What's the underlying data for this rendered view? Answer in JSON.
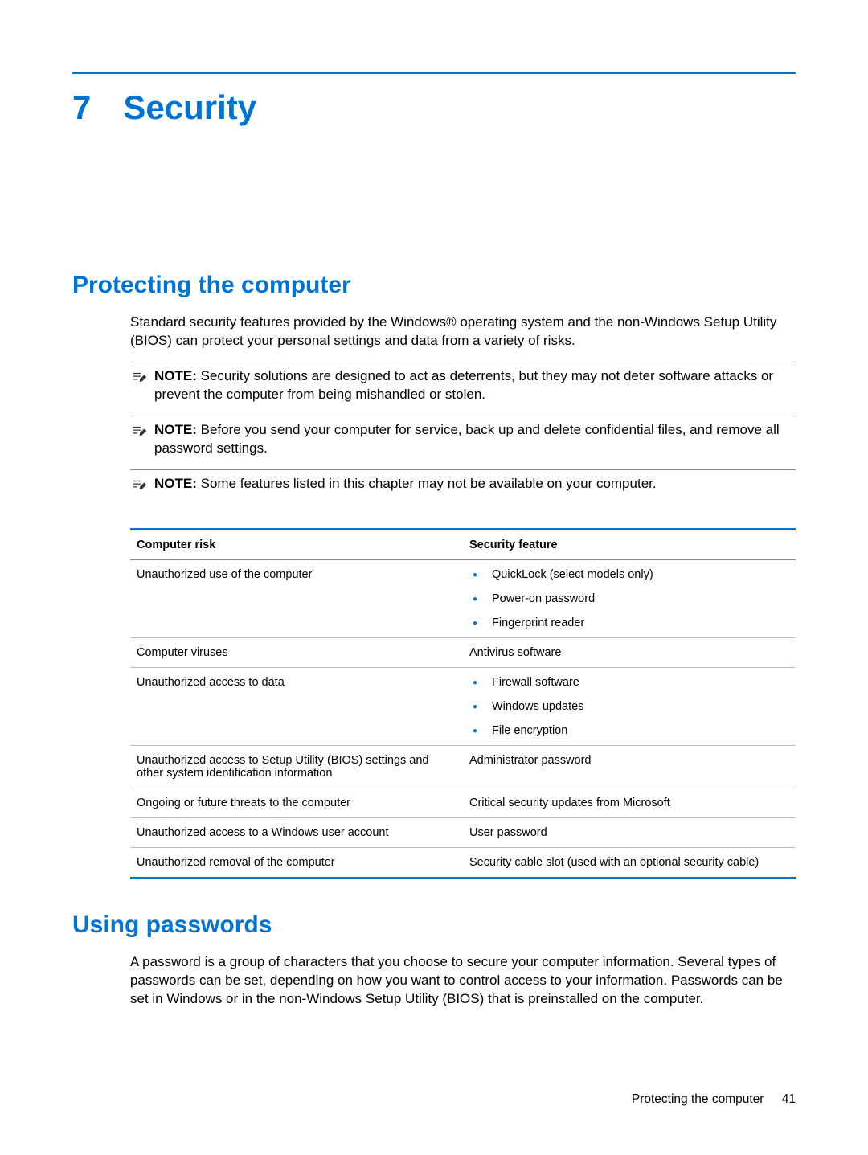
{
  "chapter": {
    "number": "7",
    "title": "Security"
  },
  "section1": {
    "heading": "Protecting the computer",
    "para1": "Standard security features provided by the Windows® operating system and the non-Windows Setup Utility (BIOS) can protect your personal settings and data from a variety of risks."
  },
  "notes": [
    {
      "label": "NOTE:",
      "text": "Security solutions are designed to act as deterrents, but they may not deter software attacks or prevent the computer from being mishandled or stolen."
    },
    {
      "label": "NOTE:",
      "text": "Before you send your computer for service, back up and delete confidential files, and remove all password settings."
    },
    {
      "label": "NOTE:",
      "text": "Some features listed in this chapter may not be available on your computer."
    }
  ],
  "table": {
    "headers": {
      "col1": "Computer risk",
      "col2": "Security feature"
    },
    "rows": [
      {
        "risk": "Unauthorized use of the computer",
        "featureList": [
          "QuickLock (select models only)",
          "Power-on password",
          "Fingerprint reader"
        ]
      },
      {
        "risk": "Computer viruses",
        "featureText": "Antivirus software"
      },
      {
        "risk": "Unauthorized access to data",
        "featureList": [
          "Firewall software",
          "Windows updates",
          "File encryption"
        ]
      },
      {
        "risk": "Unauthorized access to Setup Utility (BIOS) settings and other system identification information",
        "featureText": "Administrator password"
      },
      {
        "risk": "Ongoing or future threats to the computer",
        "featureText": "Critical security updates from Microsoft"
      },
      {
        "risk": "Unauthorized access to a Windows user account",
        "featureText": "User password"
      },
      {
        "risk": "Unauthorized removal of the computer",
        "featureText": "Security cable slot (used with an optional security cable)"
      }
    ]
  },
  "section2": {
    "heading": "Using passwords",
    "para1": "A password is a group of characters that you choose to secure your computer information. Several types of passwords can be set, depending on how you want to control access to your information. Passwords can be set in Windows or in the non-Windows Setup Utility (BIOS) that is preinstalled on the computer."
  },
  "footer": {
    "text": "Protecting the computer",
    "page": "41"
  }
}
